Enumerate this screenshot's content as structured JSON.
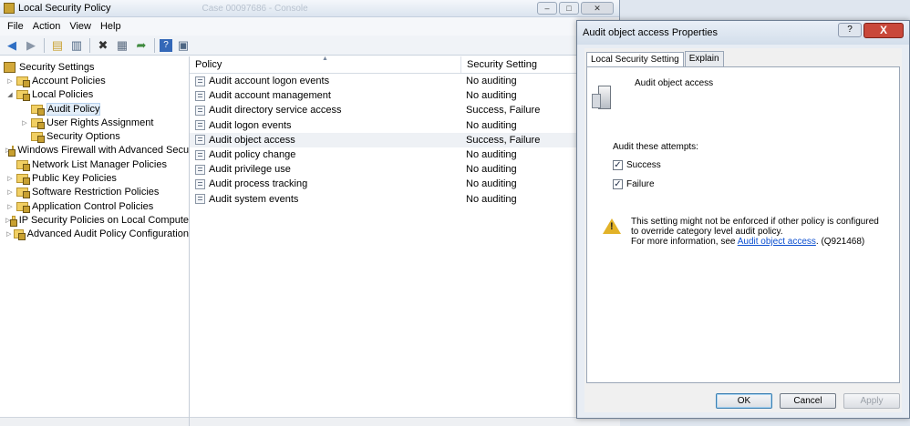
{
  "main_window": {
    "title": "Local Security Policy",
    "ghost_title": "Case 00097686 - Console",
    "menu": [
      "File",
      "Action",
      "View",
      "Help"
    ],
    "toolbar_icons": [
      "back-icon",
      "forward-icon",
      "up-folder-icon",
      "show-tree-icon",
      "delete-icon",
      "properties-icon",
      "export-icon",
      "help-icon",
      "console-icon"
    ]
  },
  "tree": {
    "root": "Security Settings",
    "items": [
      {
        "label": "Account Policies",
        "level": 1,
        "expander": "collapsed"
      },
      {
        "label": "Local Policies",
        "level": 1,
        "expander": "expanded"
      },
      {
        "label": "Audit Policy",
        "level": 2,
        "expander": "none"
      },
      {
        "label": "User Rights Assignment",
        "level": 2,
        "expander": "collapsed"
      },
      {
        "label": "Security Options",
        "level": 2,
        "expander": "none"
      },
      {
        "label": "Windows Firewall with Advanced Secu",
        "level": 1,
        "expander": "collapsed"
      },
      {
        "label": "Network List Manager Policies",
        "level": 1,
        "expander": "none"
      },
      {
        "label": "Public Key Policies",
        "level": 1,
        "expander": "collapsed"
      },
      {
        "label": "Software Restriction Policies",
        "level": 1,
        "expander": "collapsed"
      },
      {
        "label": "Application Control Policies",
        "level": 1,
        "expander": "collapsed"
      },
      {
        "label": "IP Security Policies on Local Compute",
        "level": 1,
        "expander": "collapsed"
      },
      {
        "label": "Advanced Audit Policy Configuration",
        "level": 1,
        "expander": "collapsed"
      }
    ]
  },
  "list": {
    "headers": [
      "Policy",
      "Security Setting"
    ],
    "rows": [
      {
        "policy": "Audit account logon events",
        "setting": "No auditing"
      },
      {
        "policy": "Audit account management",
        "setting": "No auditing"
      },
      {
        "policy": "Audit directory service access",
        "setting": "Success, Failure"
      },
      {
        "policy": "Audit logon events",
        "setting": "No auditing"
      },
      {
        "policy": "Audit object access",
        "setting": "Success, Failure"
      },
      {
        "policy": "Audit policy change",
        "setting": "No auditing"
      },
      {
        "policy": "Audit privilege use",
        "setting": "No auditing"
      },
      {
        "policy": "Audit process tracking",
        "setting": "No auditing"
      },
      {
        "policy": "Audit system events",
        "setting": "No auditing"
      }
    ]
  },
  "dialog": {
    "title": "Audit object access Properties",
    "help_btn": "?",
    "close_btn": "X",
    "tabs": [
      "Local Security Setting",
      "Explain"
    ],
    "heading": "Audit object access",
    "attempts_label": "Audit these attempts:",
    "success_label": "Success",
    "failure_label": "Failure",
    "success_checked": true,
    "failure_checked": true,
    "warning_line1": "This setting might not be enforced if other policy is configured to override category level audit policy.",
    "warning_line2_prefix": "For more information, see ",
    "warning_link": "Audit object access",
    "warning_line2_suffix": ". (Q921468)",
    "ok": "OK",
    "cancel": "Cancel",
    "apply": "Apply"
  }
}
